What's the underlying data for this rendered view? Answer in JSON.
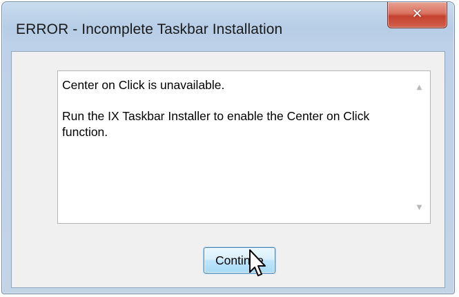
{
  "dialog": {
    "title": "ERROR - Incomplete Taskbar Installation",
    "close_icon": "close-icon",
    "close_glyph": "✕",
    "message_lines": [
      "Center on Click is unavailable.",
      "Run the IX Taskbar Installer to enable the Center on Click function."
    ],
    "scroll_up_glyph": "▲",
    "scroll_down_glyph": "▼",
    "continue_label": "Continue"
  },
  "colors": {
    "close_button": "#c4412e",
    "frame": "#b6cde6",
    "button_highlight": "#bee6fd"
  },
  "cursor": "arrow-pointer-icon"
}
